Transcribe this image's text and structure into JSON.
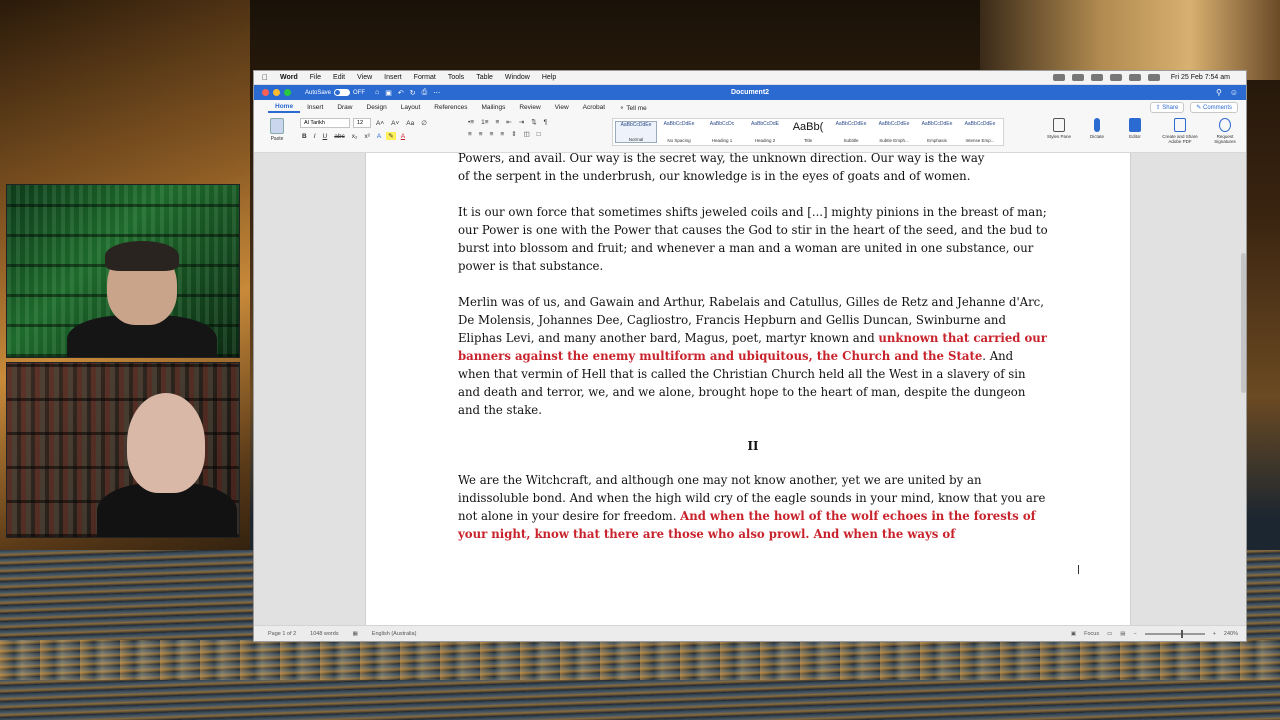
{
  "menubar": {
    "app": "Word",
    "items": [
      "File",
      "Edit",
      "View",
      "Insert",
      "Format",
      "Tools",
      "Table",
      "Window",
      "Help"
    ],
    "clock": "Fri 25 Feb 7:54 am"
  },
  "titlebar": {
    "autosave_label": "AutoSave",
    "autosave_state": "OFF",
    "document_title": "Document2"
  },
  "tabs": {
    "items": [
      "Home",
      "Insert",
      "Draw",
      "Design",
      "Layout",
      "References",
      "Mailings",
      "Review",
      "View",
      "Acrobat"
    ],
    "tell_me": "Tell me",
    "share": "Share",
    "comments": "Comments"
  },
  "ribbon": {
    "paste": "Paste",
    "font_name": "Al Tarikh",
    "font_size": "12",
    "styles": [
      {
        "sample": "AaBbCcDdEe",
        "label": "Normal"
      },
      {
        "sample": "AaBbCcDdEe",
        "label": "No Spacing"
      },
      {
        "sample": "AaBbCcDc",
        "label": "Heading 1"
      },
      {
        "sample": "AaBbCcDdE",
        "label": "Heading 2"
      },
      {
        "sample": "AaBb(",
        "label": "Title"
      },
      {
        "sample": "AaBbCcDdEe",
        "label": "Subtitle"
      },
      {
        "sample": "AaBbCcDdEe",
        "label": "Subtle Emph..."
      },
      {
        "sample": "AaBbCcDdEe",
        "label": "Emphasis"
      },
      {
        "sample": "AaBbCcDdEe",
        "label": "Intense Emp..."
      }
    ],
    "tools": [
      "Styles Pane",
      "Dictate",
      "Editor",
      "Create and Share Adobe PDF",
      "Request Signatures"
    ]
  },
  "document": {
    "para1_line1": "Powers, and avail. Our way is the secret way, the unknown direction. Our way is the way",
    "para1_line2": "of the serpent in the underbrush, our knowledge is in the eyes of goats and of women.",
    "para2": "It is our own force that sometimes shifts jeweled coils and [...] mighty pinions in the breast of man; our Power is one with the Power that causes the God to stir in the heart of the seed, and the bud to burst into blossom and fruit; and whenever a man and a woman are united in one substance, our power is that substance.",
    "para3_a": "Merlin was of us, and Gawain and Arthur, Rabelais and Catullus, Gilles de Retz and Jehanne d'Arc, De Molensis, Johannes Dee, Cagliostro, Francis Hepburn and Gellis Duncan, Swinburne and Eliphas Levi, and many another bard, Magus, poet, martyr known and ",
    "para3_red": "unknown that carried our banners against the enemy multiform and ubiquitous, the Church and the State",
    "para3_b": ". And when that vermin of Hell that is called the Christian Church held all the West in a slavery of sin and death and terror, we, and we alone, brought hope to the heart of man, despite the dungeon and the stake.",
    "heading": "II",
    "para4_a": "We are the Witchcraft, and although one may not know another, yet we are united by an indissoluble bond. And when the high wild cry of the eagle sounds in your mind, know that you are not alone in your desire for freedom. ",
    "para4_red": "And when the howl of the wolf echoes in the forests of your night, know that there are those who also prowl. And when the ways of"
  },
  "statusbar": {
    "page": "Page 1 of 2",
    "words": "1048 words",
    "language": "English (Australia)",
    "focus": "Focus",
    "zoom": "240%"
  },
  "colors": {
    "accent": "#2b6ad0",
    "highlight_red": "#c8232c"
  }
}
